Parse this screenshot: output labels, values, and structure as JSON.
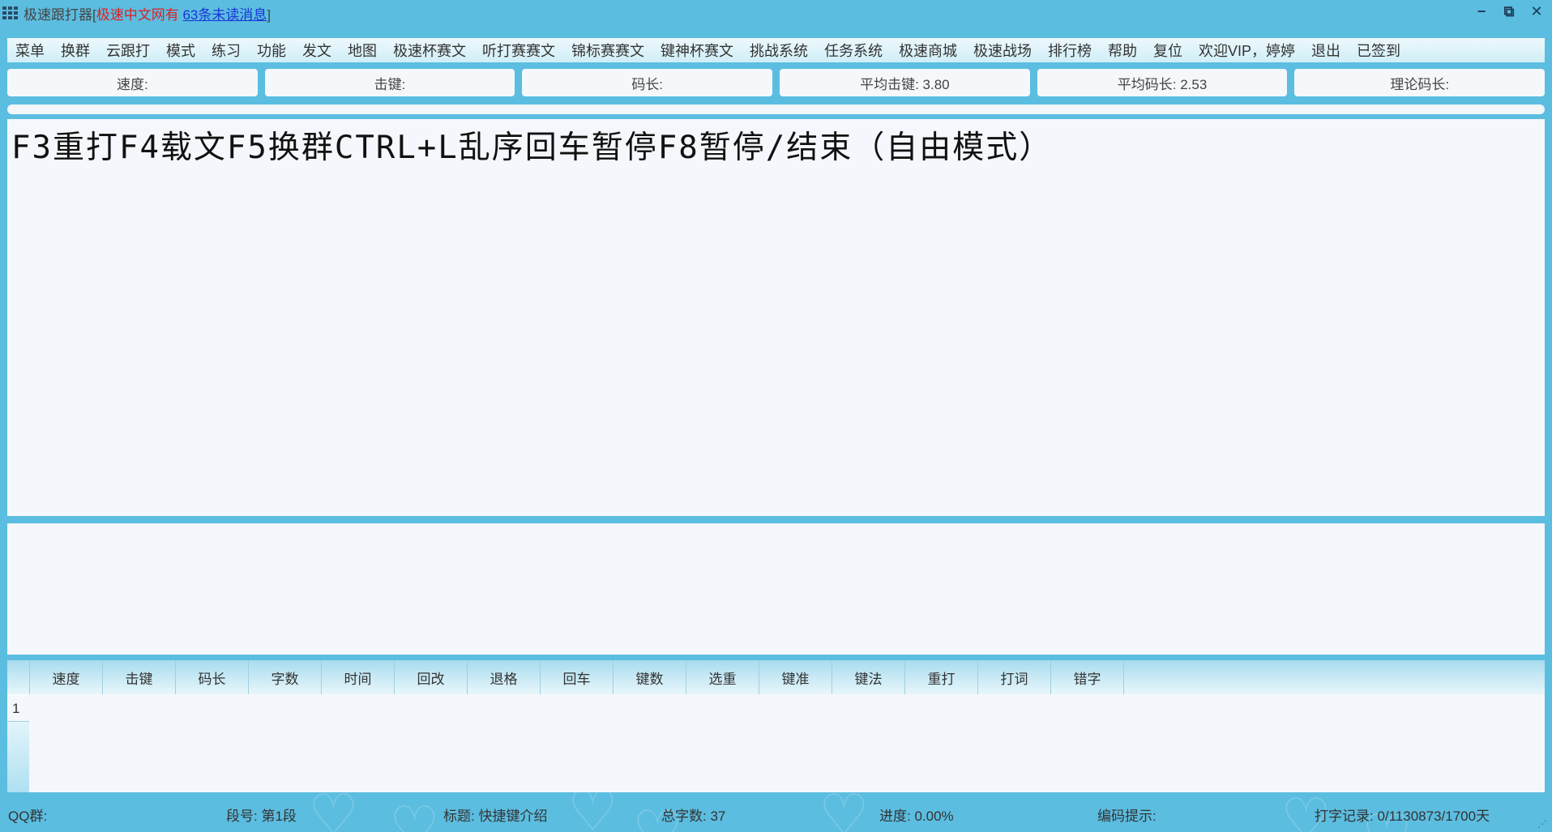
{
  "title_bar": {
    "app_name": "极速跟打器[",
    "site_name": "极速中文网有",
    "unread_link": "63条未读消息",
    "close_bracket": "]",
    "controls": {
      "minimize": "−",
      "restore": "⧉",
      "close": "✕"
    }
  },
  "menu": {
    "items": [
      "菜单",
      "换群",
      "云跟打",
      "模式",
      "练习",
      "功能",
      "发文",
      "地图",
      "极速杯赛文",
      "听打赛赛文",
      "锦标赛赛文",
      "键神杯赛文",
      "挑战系统",
      "任务系统",
      "极速商城",
      "极速战场",
      "排行榜",
      "帮助",
      "复位",
      "欢迎VIP，婷婷",
      "退出",
      "已签到"
    ]
  },
  "stats": [
    "速度:",
    "击键:",
    "码长:",
    "平均击键: 3.80",
    "平均码长: 2.53",
    "理论码长:"
  ],
  "reference_text": "F3重打F4载文F5换群CTRL+L乱序回车暂停F8暂停/结束（自由模式）",
  "results_table": {
    "columns": [
      "速度",
      "击键",
      "码长",
      "字数",
      "时间",
      "回改",
      "退格",
      "回车",
      "键数",
      "选重",
      "键准",
      "键法",
      "重打",
      "打词",
      "错字"
    ],
    "rows": [
      "1"
    ]
  },
  "status_bar": {
    "qq_group": "QQ群:",
    "segment": "段号: 第1段",
    "title": "标题: 快捷键介绍",
    "total_chars": "总字数: 37",
    "progress": "进度: 0.00%",
    "encoding_hint": "编码提示:",
    "typing_record": "打字记录: 0/1130873/1700天"
  },
  "colors": {
    "background": "#5bbde0",
    "panel": "#f4f7fb",
    "title_red": "#e02020",
    "link_blue": "#1a34d6"
  }
}
